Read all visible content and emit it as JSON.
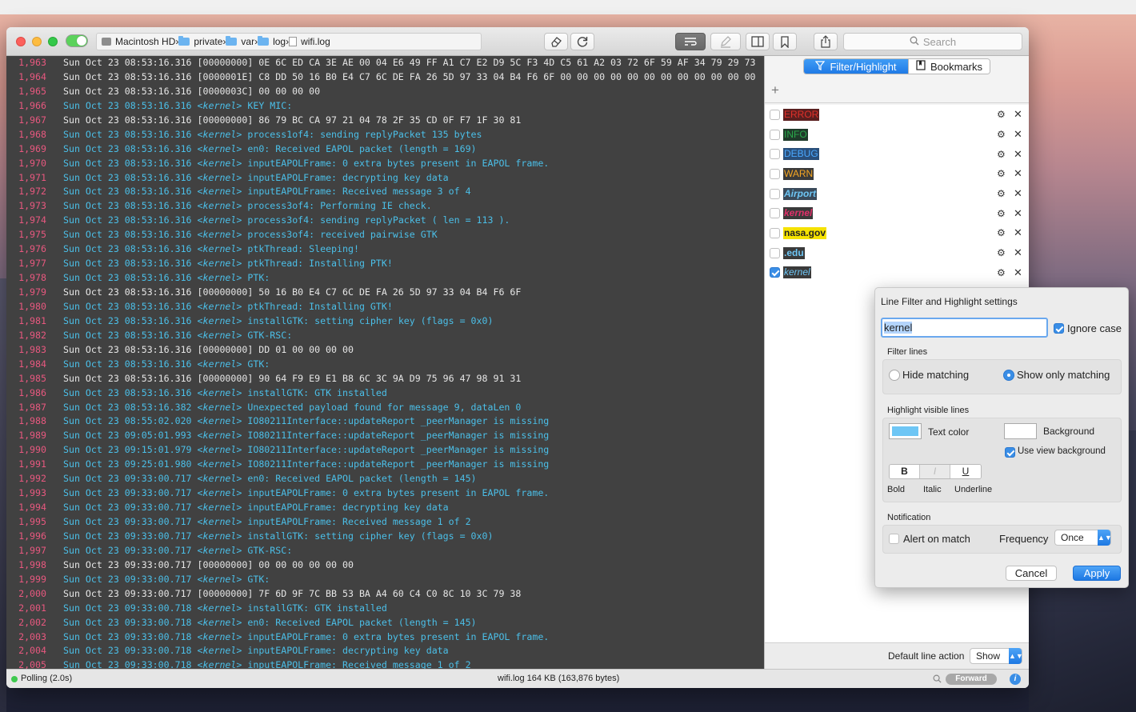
{
  "window": {
    "path": [
      {
        "label": "Macintosh HD",
        "icon": "disk"
      },
      {
        "label": "private",
        "icon": "folder"
      },
      {
        "label": "var",
        "icon": "folder"
      },
      {
        "label": "log",
        "icon": "folder"
      },
      {
        "label": "wifi.log",
        "icon": "file"
      }
    ],
    "search_placeholder": "Search"
  },
  "log_lines": [
    {
      "n": "1,963",
      "ts": "Sun Oct 23 08:53:16.316",
      "k": false,
      "msg": " [00000000] 0E 6C ED CA 3E AE 00 04 E6 49 FF A1 C7 E2 D9 5C F3 4D C5 61 A2 03 72 6F 59 AF 34 79 29 73"
    },
    {
      "n": "1,964",
      "ts": "Sun Oct 23 08:53:16.316",
      "k": false,
      "msg": " [0000001E] C8 DD 50 16 B0 E4 C7 6C DE FA 26 5D 97 33 04 B4 F6 6F 00 00 00 00 00 00 00 00 00 00 00 00"
    },
    {
      "n": "1,965",
      "ts": "Sun Oct 23 08:53:16.316",
      "k": false,
      "msg": " [0000003C] 00 00 00 00"
    },
    {
      "n": "1,966",
      "ts": "Sun Oct 23 08:53:16.316",
      "k": true,
      "msg": " KEY MIC:"
    },
    {
      "n": "1,967",
      "ts": "Sun Oct 23 08:53:16.316",
      "k": false,
      "msg": " [00000000] 86 79 BC CA 97 21 04 78 2F 35 CD 0F F7 1F 30 81"
    },
    {
      "n": "1,968",
      "ts": "Sun Oct 23 08:53:16.316",
      "k": true,
      "msg": " process1of4: sending replyPacket 135 bytes"
    },
    {
      "n": "1,969",
      "ts": "Sun Oct 23 08:53:16.316",
      "k": true,
      "msg": " en0: Received EAPOL packet (length = 169)"
    },
    {
      "n": "1,970",
      "ts": "Sun Oct 23 08:53:16.316",
      "k": true,
      "msg": " inputEAPOLFrame: 0 extra bytes present in EAPOL frame."
    },
    {
      "n": "1,971",
      "ts": "Sun Oct 23 08:53:16.316",
      "k": true,
      "msg": " inputEAPOLFrame: decrypting key data"
    },
    {
      "n": "1,972",
      "ts": "Sun Oct 23 08:53:16.316",
      "k": true,
      "msg": " inputEAPOLFrame: Received message 3 of 4"
    },
    {
      "n": "1,973",
      "ts": "Sun Oct 23 08:53:16.316",
      "k": true,
      "msg": " process3of4: Performing IE check."
    },
    {
      "n": "1,974",
      "ts": "Sun Oct 23 08:53:16.316",
      "k": true,
      "msg": " process3of4: sending replyPacket ( len = 113 )."
    },
    {
      "n": "1,975",
      "ts": "Sun Oct 23 08:53:16.316",
      "k": true,
      "msg": " process3of4: received pairwise GTK"
    },
    {
      "n": "1,976",
      "ts": "Sun Oct 23 08:53:16.316",
      "k": true,
      "msg": " ptkThread: Sleeping!"
    },
    {
      "n": "1,977",
      "ts": "Sun Oct 23 08:53:16.316",
      "k": true,
      "msg": " ptkThread: Installing PTK!"
    },
    {
      "n": "1,978",
      "ts": "Sun Oct 23 08:53:16.316",
      "k": true,
      "msg": " PTK:"
    },
    {
      "n": "1,979",
      "ts": "Sun Oct 23 08:53:16.316",
      "k": false,
      "msg": " [00000000] 50 16 B0 E4 C7 6C DE FA 26 5D 97 33 04 B4 F6 6F"
    },
    {
      "n": "1,980",
      "ts": "Sun Oct 23 08:53:16.316",
      "k": true,
      "msg": " ptkThread: Installing GTK!"
    },
    {
      "n": "1,981",
      "ts": "Sun Oct 23 08:53:16.316",
      "k": true,
      "msg": " installGTK: setting cipher key (flags = 0x0)"
    },
    {
      "n": "1,982",
      "ts": "Sun Oct 23 08:53:16.316",
      "k": true,
      "msg": " GTK-RSC:"
    },
    {
      "n": "1,983",
      "ts": "Sun Oct 23 08:53:16.316",
      "k": false,
      "msg": " [00000000] DD 01 00 00 00 00"
    },
    {
      "n": "1,984",
      "ts": "Sun Oct 23 08:53:16.316",
      "k": true,
      "msg": " GTK:"
    },
    {
      "n": "1,985",
      "ts": "Sun Oct 23 08:53:16.316",
      "k": false,
      "msg": " [00000000] 90 64 F9 E9 E1 B8 6C 3C 9A D9 75 96 47 98 91 31"
    },
    {
      "n": "1,986",
      "ts": "Sun Oct 23 08:53:16.316",
      "k": true,
      "msg": " installGTK: GTK installed"
    },
    {
      "n": "1,987",
      "ts": "Sun Oct 23 08:53:16.382",
      "k": true,
      "msg": " Unexpected payload found for message 9, dataLen 0"
    },
    {
      "n": "1,988",
      "ts": "Sun Oct 23 08:55:02.020",
      "k": true,
      "msg": " IO80211Interface::updateReport _peerManager is missing"
    },
    {
      "n": "1,989",
      "ts": "Sun Oct 23 09:05:01.993",
      "k": true,
      "msg": " IO80211Interface::updateReport _peerManager is missing"
    },
    {
      "n": "1,990",
      "ts": "Sun Oct 23 09:15:01.979",
      "k": true,
      "msg": " IO80211Interface::updateReport _peerManager is missing"
    },
    {
      "n": "1,991",
      "ts": "Sun Oct 23 09:25:01.980",
      "k": true,
      "msg": " IO80211Interface::updateReport _peerManager is missing"
    },
    {
      "n": "1,992",
      "ts": "Sun Oct 23 09:33:00.717",
      "k": true,
      "msg": " en0: Received EAPOL packet (length = 145)"
    },
    {
      "n": "1,993",
      "ts": "Sun Oct 23 09:33:00.717",
      "k": true,
      "msg": " inputEAPOLFrame: 0 extra bytes present in EAPOL frame."
    },
    {
      "n": "1,994",
      "ts": "Sun Oct 23 09:33:00.717",
      "k": true,
      "msg": " inputEAPOLFrame: decrypting key data"
    },
    {
      "n": "1,995",
      "ts": "Sun Oct 23 09:33:00.717",
      "k": true,
      "msg": " inputEAPOLFrame: Received message 1 of 2"
    },
    {
      "n": "1,996",
      "ts": "Sun Oct 23 09:33:00.717",
      "k": true,
      "msg": " installGTK: setting cipher key (flags = 0x0)"
    },
    {
      "n": "1,997",
      "ts": "Sun Oct 23 09:33:00.717",
      "k": true,
      "msg": " GTK-RSC:"
    },
    {
      "n": "1,998",
      "ts": "Sun Oct 23 09:33:00.717",
      "k": false,
      "msg": " [00000000] 00 00 00 00 00 00"
    },
    {
      "n": "1,999",
      "ts": "Sun Oct 23 09:33:00.717",
      "k": true,
      "msg": " GTK:"
    },
    {
      "n": "2,000",
      "ts": "Sun Oct 23 09:33:00.717",
      "k": false,
      "msg": " [00000000] 7F 6D 9F 7C BB 53 BA A4 60 C4 C0 8C 10 3C 79 38"
    },
    {
      "n": "2,001",
      "ts": "Sun Oct 23 09:33:00.718",
      "k": true,
      "msg": " installGTK: GTK installed"
    },
    {
      "n": "2,002",
      "ts": "Sun Oct 23 09:33:00.718",
      "k": true,
      "msg": " en0: Received EAPOL packet (length = 145)"
    },
    {
      "n": "2,003",
      "ts": "Sun Oct 23 09:33:00.718",
      "k": true,
      "msg": " inputEAPOLFrame: 0 extra bytes present in EAPOL frame."
    },
    {
      "n": "2,004",
      "ts": "Sun Oct 23 09:33:00.718",
      "k": true,
      "msg": " inputEAPOLFrame: decrypting key data"
    },
    {
      "n": "2,005",
      "ts": "Sun Oct 23 09:33:00.718",
      "k": true,
      "msg": " inputEAPOLFrame: Received message 1 of 2"
    }
  ],
  "kernel_tag": "<kernel>",
  "sidebar": {
    "tabs": [
      {
        "label": "Filter/Highlight",
        "active": true,
        "icon": "funnel-icon"
      },
      {
        "label": "Bookmarks",
        "active": false,
        "icon": "bookmark-icon"
      }
    ],
    "filters": [
      {
        "label": "ERROR",
        "checked": false,
        "fg": "#e0302a",
        "bg": "#5a1f1f",
        "bold": false,
        "italic": false
      },
      {
        "label": "INFO",
        "checked": false,
        "fg": "#2aa84a",
        "bg": "#1f3a2a",
        "bold": false,
        "italic": false
      },
      {
        "label": "DEBUG",
        "checked": false,
        "fg": "#4aa8ff",
        "bg": "#2a4f7a",
        "bold": false,
        "italic": false
      },
      {
        "label": "WARN",
        "checked": false,
        "fg": "#f5a623",
        "bg": "#3a3a3a",
        "bold": false,
        "italic": false
      },
      {
        "label": "Airport",
        "checked": false,
        "fg": "#6ec6f5",
        "bg": "#3a4a5a",
        "bold": true,
        "italic": true
      },
      {
        "label": "kernel",
        "checked": false,
        "fg": "#e0306a",
        "bg": "#3a3a3a",
        "bold": true,
        "italic": true
      },
      {
        "label": "nasa.gov",
        "checked": false,
        "fg": "#222222",
        "bg": "#f5e200",
        "bold": true,
        "italic": false
      },
      {
        "label": ".edu",
        "checked": false,
        "fg": "#6ec6f5",
        "bg": "#3a3a3a",
        "bold": true,
        "italic": false
      },
      {
        "label": "kernel",
        "checked": true,
        "fg": "#6ec6f5",
        "bg": "#3a3a3a",
        "bold": false,
        "italic": true
      }
    ],
    "default_action_label": "Default line action",
    "default_action_value": "Show"
  },
  "popover": {
    "title": "Line Filter and Highlight settings",
    "pattern_value": "kernel",
    "ignore_case_label": "Ignore case",
    "ignore_case_checked": true,
    "filter_lines_label": "Filter lines",
    "hide_matching_label": "Hide matching",
    "show_only_matching_label": "Show only matching",
    "highlight_label": "Highlight visible lines",
    "text_color_label": "Text color",
    "text_color": "#6ec6f5",
    "background_label": "Background",
    "use_view_bg_label": "Use view background",
    "use_view_bg_checked": true,
    "bold_label": "Bold",
    "italic_label": "Italic",
    "underline_label": "Underline",
    "bold_glyph": "B",
    "italic_glyph": "I",
    "underline_glyph": "U",
    "notification_label": "Notification",
    "alert_label": "Alert on match",
    "frequency_label": "Frequency",
    "frequency_value": "Once",
    "cancel_label": "Cancel",
    "apply_label": "Apply"
  },
  "status": {
    "polling": "Polling (2.0s)",
    "file_info": "wifi.log  164 KB (163,876 bytes)",
    "forward_label": "Forward"
  }
}
